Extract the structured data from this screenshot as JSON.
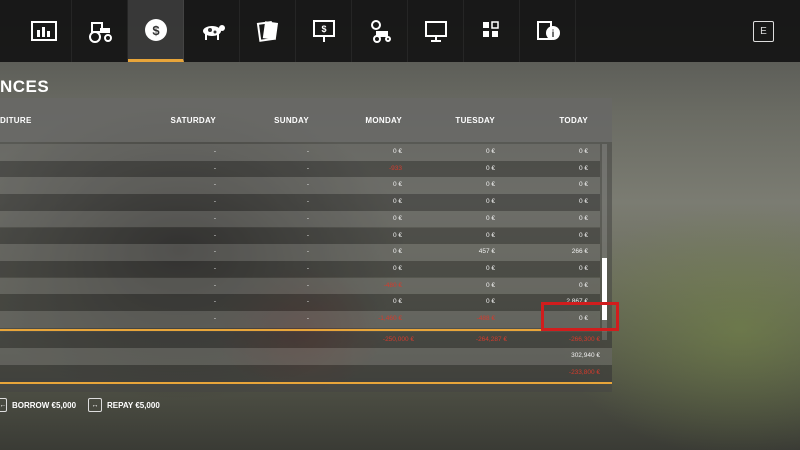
{
  "nav": {
    "tabs": [
      {
        "icon": "statistics-icon"
      },
      {
        "icon": "tractor-icon"
      },
      {
        "icon": "money-icon",
        "active": true
      },
      {
        "icon": "cow-icon"
      },
      {
        "icon": "contracts-icon"
      },
      {
        "icon": "price-board-icon"
      },
      {
        "icon": "vehicle-settings-icon"
      },
      {
        "icon": "computer-icon"
      },
      {
        "icon": "production-icon"
      },
      {
        "icon": "help-icon"
      }
    ],
    "exit_key": "E"
  },
  "page": {
    "title": "NCES"
  },
  "table": {
    "columns": [
      "DITURE",
      "SATURDAY",
      "SUNDAY",
      "MONDAY",
      "TUESDAY",
      "TODAY"
    ],
    "rows": [
      {
        "saturday": "-",
        "sunday": "-",
        "monday": "0 €",
        "tuesday": "0 €",
        "today": "0 €"
      },
      {
        "saturday": "-",
        "sunday": "-",
        "monday": "-933",
        "monday_neg": true,
        "tuesday": "0 €",
        "today": "0 €"
      },
      {
        "saturday": "-",
        "sunday": "-",
        "monday": "0 €",
        "tuesday": "0 €",
        "today": "0 €"
      },
      {
        "saturday": "-",
        "sunday": "-",
        "monday": "0 €",
        "tuesday": "0 €",
        "today": "0 €"
      },
      {
        "saturday": "-",
        "sunday": "-",
        "monday": "0 €",
        "tuesday": "0 €",
        "today": "0 €"
      },
      {
        "saturday": "-",
        "sunday": "-",
        "monday": "0 €",
        "tuesday": "0 €",
        "today": "0 €"
      },
      {
        "saturday": "-",
        "sunday": "-",
        "monday": "0 €",
        "tuesday": "457 €",
        "today": "266 €"
      },
      {
        "saturday": "-",
        "sunday": "-",
        "monday": "0 €",
        "tuesday": "0 €",
        "today": "0 €"
      },
      {
        "saturday": "-",
        "sunday": "-",
        "monday": "-480 €",
        "monday_neg": true,
        "tuesday": "0 €",
        "today": "0 €"
      },
      {
        "saturday": "-",
        "sunday": "-",
        "monday": "0 €",
        "tuesday": "0 €",
        "today": "2,867 €"
      },
      {
        "saturday": "-",
        "sunday": "-",
        "monday": "-1,460 €",
        "monday_neg": true,
        "tuesday": "-488 €",
        "tuesday_neg": true,
        "today": "0 €"
      }
    ],
    "totals": [
      {
        "monday": "-250,000 €",
        "tuesday": "-264,287 €",
        "today": "-266,300 €"
      },
      {
        "today": "302,940 €"
      },
      {
        "today": "-233,800 €"
      }
    ]
  },
  "actions": {
    "borrow_key": "←",
    "borrow_label": "BORROW €5,000",
    "repay_key": "↔",
    "repay_label": "REPAY €5,000"
  },
  "colors": {
    "accent": "#e8a53a",
    "negative": "#d43b2d",
    "highlight": "#d11d1d"
  }
}
